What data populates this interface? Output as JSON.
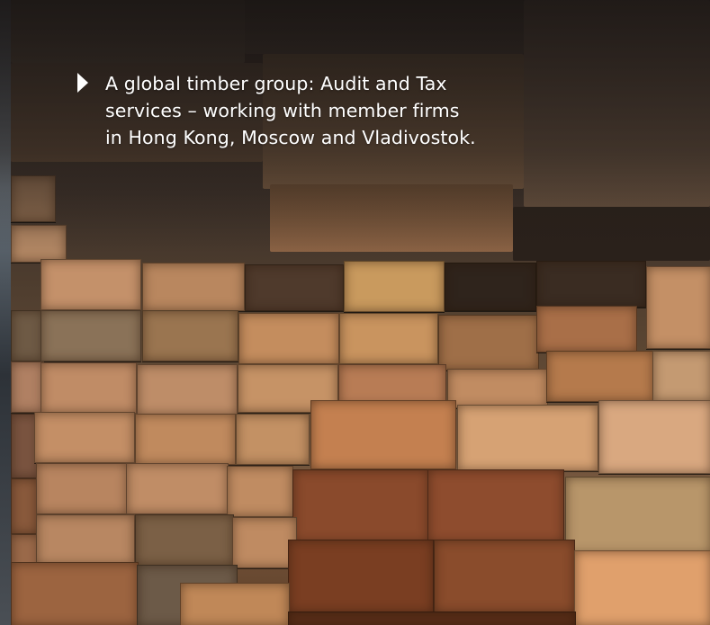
{
  "caption": {
    "text": "A global timber group: Audit and Tax\nservices – working with member firms\nin Hong Kong, Moscow and Vladivostok."
  },
  "icons": {
    "bullet": "play-triangle-icon"
  },
  "colors": {
    "caption_text": "#ffffff",
    "wood_light": "#c98a5c",
    "wood_mid": "#a9724a",
    "wood_dark": "#7a4a2c"
  }
}
